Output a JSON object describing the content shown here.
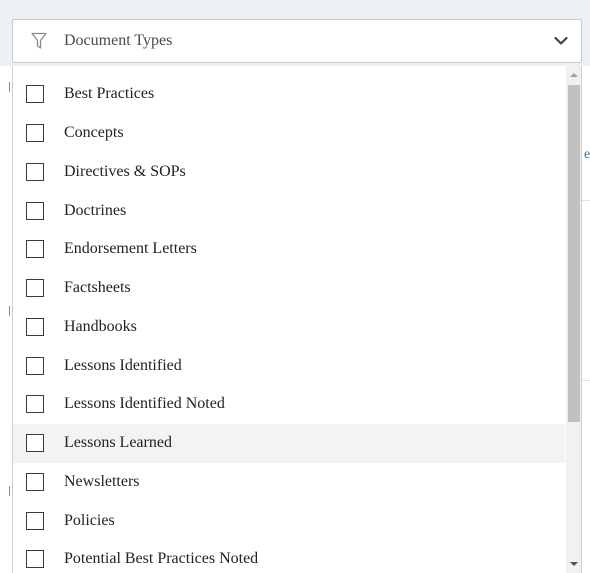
{
  "dropdown": {
    "placeholder": "Document Types",
    "filter_icon": "filter-icon",
    "toggle_icon": "chevron-down-icon"
  },
  "options": [
    {
      "label": "Best Practices",
      "checked": false
    },
    {
      "label": "Concepts",
      "checked": false
    },
    {
      "label": "Directives & SOPs",
      "checked": false
    },
    {
      "label": "Doctrines",
      "checked": false
    },
    {
      "label": "Endorsement Letters",
      "checked": false
    },
    {
      "label": "Factsheets",
      "checked": false
    },
    {
      "label": "Handbooks",
      "checked": false
    },
    {
      "label": "Lessons Identified",
      "checked": false
    },
    {
      "label": "Lessons Identified Noted",
      "checked": false
    },
    {
      "label": "Lessons Learned",
      "checked": false,
      "hovered": true
    },
    {
      "label": "Newsletters",
      "checked": false
    },
    {
      "label": "Policies",
      "checked": false
    },
    {
      "label": "Potential Best Practices Noted",
      "checked": false
    }
  ],
  "background": {
    "edge_text": "e"
  },
  "colors": {
    "hover_bg": "#f3f3f3",
    "scroll_thumb": "#c1c1c1",
    "link_fragment": "#3a6ea5"
  }
}
